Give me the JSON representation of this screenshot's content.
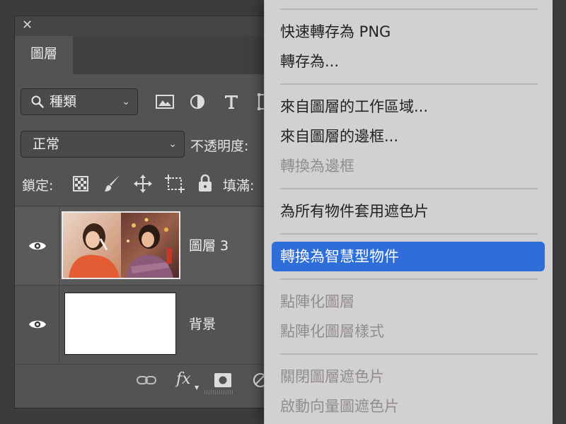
{
  "layers_panel": {
    "close_glyph": "✕",
    "tab_label": "圖層",
    "filter": {
      "selected": "種類",
      "icons": [
        "image-filter-icon",
        "adjustment-filter-icon",
        "type-filter-icon",
        "shape-filter-icon"
      ]
    },
    "blend_mode": {
      "selected": "正常"
    },
    "opacity_label": "不透明度:",
    "lock_label": "鎖定:",
    "lock_icons": [
      "lock-transparent-pixels-icon",
      "lock-image-pixels-icon",
      "lock-position-icon",
      "lock-artboard-icon",
      "lock-all-icon"
    ],
    "fill_label": "填滿:",
    "layers": [
      {
        "name": "圖層 3",
        "visible": true,
        "selected": true,
        "thumbnail": "photo"
      },
      {
        "name": "背景",
        "visible": true,
        "selected": false,
        "thumbnail": "white"
      }
    ],
    "bottom_icons": [
      "link-layers-icon",
      "fx-icon",
      "add-mask-icon",
      "adjustment-layer-icon"
    ],
    "fx_label": "fx"
  },
  "context_menu": {
    "items": [
      {
        "label": "快速轉存為 PNG",
        "enabled": true
      },
      {
        "label": "轉存為...",
        "enabled": true
      },
      {
        "label": "來自圖層的工作區域...",
        "enabled": true
      },
      {
        "label": "來自圖層的邊框...",
        "enabled": true
      },
      {
        "label": "轉換為邊框",
        "enabled": false
      },
      {
        "label": "為所有物件套用遮色片",
        "enabled": true
      },
      {
        "label": "轉換為智慧型物件",
        "enabled": true,
        "highlighted": true
      },
      {
        "label": "點陣化圖層",
        "enabled": false
      },
      {
        "label": "點陣化圖層樣式",
        "enabled": false
      },
      {
        "label": "關閉圖層遮色片",
        "enabled": false
      },
      {
        "label": "啟動向量圖遮色片",
        "enabled": false
      }
    ]
  },
  "colors": {
    "panel_bg": "#535353",
    "menu_bg": "#d3d0d3",
    "highlight": "#2f6ed8",
    "disabled_text": "#908d90"
  }
}
